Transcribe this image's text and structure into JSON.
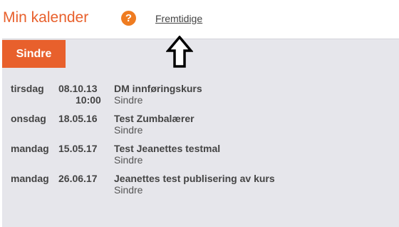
{
  "header": {
    "title": "Min kalender",
    "help_icon": "?",
    "future_link": "Fremtidige"
  },
  "tabs": {
    "person": "Sindre"
  },
  "events": [
    {
      "day": "tirsdag",
      "date": "08.10.13",
      "time": "10:00",
      "name": "DM innføringskurs",
      "person": "Sindre"
    },
    {
      "day": "onsdag",
      "date": "18.05.16",
      "time": "",
      "name": "Test Zumbalærer",
      "person": "Sindre"
    },
    {
      "day": "mandag",
      "date": "15.05.17",
      "time": "",
      "name": "Test Jeanettes testmal",
      "person": "Sindre"
    },
    {
      "day": "mandag",
      "date": "26.06.17",
      "time": "",
      "name": "Jeanettes test publisering av kurs",
      "person": "Sindre"
    }
  ],
  "icons": {
    "help": "question-circle-icon",
    "annotation": "up-arrow-icon"
  },
  "colors": {
    "accent": "#e8602c",
    "help": "#ef7c21",
    "panel": "#e6e6eb",
    "text": "#444444"
  }
}
